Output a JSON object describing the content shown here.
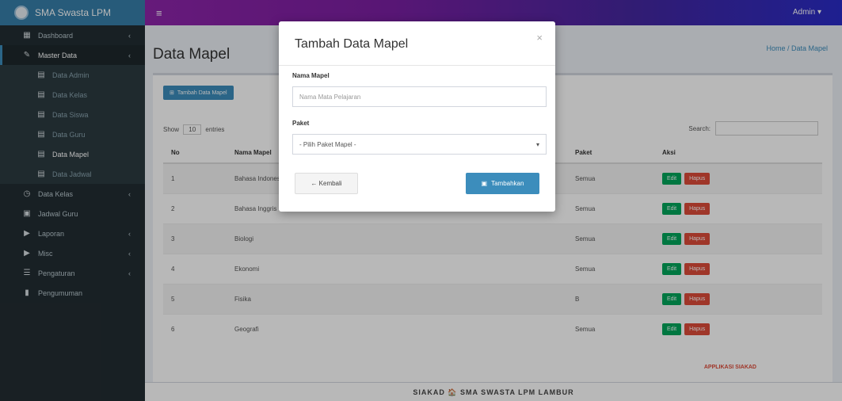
{
  "brand": {
    "title": "SMA Swasta LPM"
  },
  "navbar": {
    "toggle_icon": "≡",
    "user_label": "Admin ▾"
  },
  "sidebar": {
    "items": [
      {
        "icon": "dashboard-icon",
        "label": "Dashboard",
        "has_children": true
      },
      {
        "icon": "master-data-icon",
        "label": "Master Data",
        "has_children": true,
        "active": true
      },
      {
        "icon": "sub-icon",
        "label": "Data Admin",
        "sub": true
      },
      {
        "icon": "sub-icon",
        "label": "Data Kelas",
        "sub": true
      },
      {
        "icon": "sub-icon",
        "label": "Data Siswa",
        "sub": true
      },
      {
        "icon": "sub-icon",
        "label": "Data Guru",
        "sub": true
      },
      {
        "icon": "sub-icon",
        "label": "Data Mapel",
        "sub": true,
        "current": true
      },
      {
        "icon": "sub-icon",
        "label": "Data Jadwal",
        "sub": true
      },
      {
        "icon": "class-icon",
        "label": "Data Kelas",
        "has_children": true
      },
      {
        "icon": "teacher-icon",
        "label": "Jadwal Guru"
      },
      {
        "icon": "report-icon",
        "label": "Laporan",
        "has_children": true
      },
      {
        "icon": "misc-icon",
        "label": "Misc",
        "has_children": true
      },
      {
        "icon": "settings-icon",
        "label": "Pengaturan",
        "has_children": true
      },
      {
        "icon": "announcement-icon",
        "label": "Pengumuman"
      }
    ]
  },
  "header": {
    "title": "Data Mapel",
    "breadcrumb": "Home / Data Mapel"
  },
  "box": {
    "add_label": "Tambah Data Mapel",
    "show_label": "Show",
    "show_value": "10",
    "entries_label": "entries",
    "search_label": "Search:"
  },
  "table": {
    "headers": [
      "No",
      "Nama Mapel",
      "Paket",
      "Aksi"
    ],
    "edit_label": "Edit",
    "delete_label": "Hapus",
    "rows": [
      {
        "no": "1",
        "name": "Bahasa Indonesia",
        "paket": "Semua"
      },
      {
        "no": "2",
        "name": "Bahasa Inggris",
        "paket": "Semua"
      },
      {
        "no": "3",
        "name": "Biologi",
        "paket": "Semua"
      },
      {
        "no": "4",
        "name": "Ekonomi",
        "paket": "Semua"
      },
      {
        "no": "5",
        "name": "Fisika",
        "paket": "B"
      },
      {
        "no": "6",
        "name": "Geografi",
        "paket": "Semua"
      }
    ]
  },
  "footer": {
    "text": "SIAKAD 🏠 SMA SWASTA LPM LAMBUR",
    "badge": "APPLIKASI SIAKAD"
  },
  "modal": {
    "title": "Tambah Data Mapel",
    "close": "×",
    "name_label": "Nama Mapel",
    "name_placeholder": "Nama Mata Pelajaran",
    "paket_label": "Paket",
    "paket_value": "- Pilih Paket Mapel -",
    "back_label": "← Kembali",
    "submit_label": "Tambahkan"
  },
  "colors": {
    "sidebar": "#222d32",
    "brand": "#367fa9",
    "primary": "#3c8dbc",
    "success": "#00a65a",
    "danger": "#dd4b39"
  }
}
